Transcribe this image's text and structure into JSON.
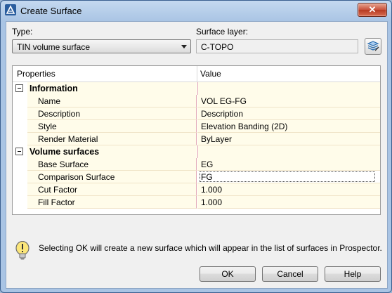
{
  "window": {
    "title": "Create Surface",
    "close_label": "✕"
  },
  "type": {
    "label": "Type:",
    "value": "TIN volume surface"
  },
  "surface_layer": {
    "label": "Surface layer:",
    "value": "C-TOPO"
  },
  "grid": {
    "col_properties": "Properties",
    "col_value": "Value",
    "categories": [
      {
        "name": "Information",
        "rows": [
          {
            "name": "Name",
            "value": "VOL EG-FG"
          },
          {
            "name": "Description",
            "value": "Description"
          },
          {
            "name": "Style",
            "value": "Elevation Banding (2D)"
          },
          {
            "name": "Render Material",
            "value": "ByLayer"
          }
        ]
      },
      {
        "name": "Volume surfaces",
        "rows": [
          {
            "name": "Base Surface",
            "value": "EG"
          },
          {
            "name": "Comparison Surface",
            "value": "FG"
          },
          {
            "name": "Cut Factor",
            "value": "1.000"
          },
          {
            "name": "Fill Factor",
            "value": "1.000"
          }
        ]
      }
    ]
  },
  "info": {
    "message": "Selecting OK will create a new surface which will appear in the list of surfaces in Prospector."
  },
  "buttons": {
    "ok": "OK",
    "cancel": "Cancel",
    "help": "Help"
  }
}
